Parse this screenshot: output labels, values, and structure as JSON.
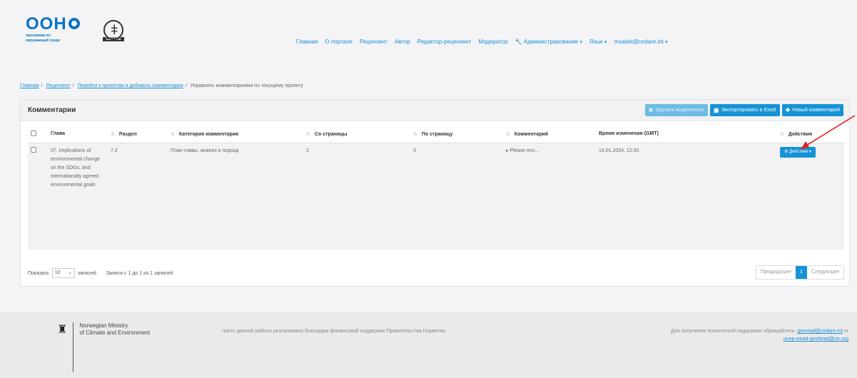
{
  "brand": {
    "logo_text": "ООН",
    "sub_line1": "программа по",
    "sub_line2": "окружающей среде",
    "partner_tag": "CEDARE"
  },
  "nav": {
    "items": [
      "Главная",
      "О портале",
      "Рецензент",
      "Автор",
      "Редактор-рецензент",
      "Модератор"
    ],
    "admin": "Администрирование",
    "lang": "Язык",
    "user": "msabet@cedare.int"
  },
  "breadcrumb": {
    "items": [
      "Главная",
      "Рецензент",
      "Перейти к проектам и добавить комментарии"
    ],
    "current": "Управлять комментариями по текущему проекту"
  },
  "card": {
    "title": "Комментарии",
    "btn_delete": "Удалить выделенное",
    "btn_export": "Экспортировать в Excel",
    "btn_new": "Новый комментарий"
  },
  "table": {
    "headers": [
      "Глава",
      "Раздел",
      "Категория комментария",
      "Со страницы",
      "По страницу",
      "Комментарий",
      "Время изменения (GMT)",
      "Действия"
    ],
    "rows": [
      {
        "chapter": "07. Implications of environmental change on the SDGs, and internationally agreed environmental goals",
        "section": "7.2",
        "category": "План главы, анализ и подход",
        "from_page": "2",
        "to_page": "3",
        "comment": "▸ Please revi...",
        "modified": "14.01.2024, 12:30",
        "action": "Действие"
      }
    ]
  },
  "table_footer": {
    "show": "Показать",
    "len_value": "10",
    "entries": "записей",
    "info": "Записи с 1 до 1 из 1 записей",
    "prev": "Предыдущее",
    "page": "1",
    "next": "Следующее"
  },
  "footer": {
    "ministry_line1": "Norwegian Ministry",
    "ministry_line2": "of Climate and Environment",
    "funding": "Часть данной работы реализована благодаря финансовой поддержке Правительства Норвегии.",
    "support_text": "Для получения технической поддержки обращайтесь:",
    "support_email1": "georead@cedare.int",
    "or": "or",
    "support_email2": "unep-ewad-geohead@un.org"
  },
  "colors": {
    "accent": "#1593d6",
    "brand": "#0a74c4",
    "annotation": "#e02020"
  }
}
